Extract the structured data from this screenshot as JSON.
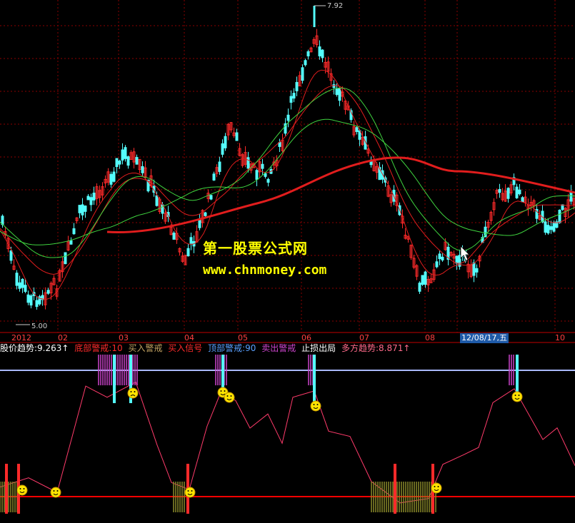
{
  "colors": {
    "background": "#000000",
    "grid": "#8b0000",
    "up_candle": "#ff2a2a",
    "down_candle": "#54fcfc",
    "ma_long": "#e11d1d",
    "ma_mid": "#3fd43f",
    "indicator_line": "#ff3b6b",
    "level_line": "#a9b8ff",
    "base_line": "#ff0000",
    "bottom_warning": "#ff2a2a",
    "buy_warning": "#c0a060",
    "top_warning": "#5aa0ff",
    "sell_warning": "#cc44cc",
    "watermark": "#ffff00"
  },
  "price_panel": {
    "high_label": "7.92",
    "low_label": "5.00",
    "x_axis_labels": [
      "2012",
      "02",
      "03",
      "04",
      "05",
      "06",
      "07",
      "08",
      "10"
    ],
    "cursor_date": "12/08/17,五"
  },
  "watermark": {
    "line1": "第一股票公式网",
    "line2": "www.chnmoney.com"
  },
  "indicator_panel": {
    "legend": [
      {
        "text": "股价趋势:9.263↑",
        "color": "#ffffff"
      },
      {
        "text": "底部警戒:10",
        "color": "#ff2a2a"
      },
      {
        "text": "买入警戒",
        "color": "#c0a060"
      },
      {
        "text": "买入信号",
        "color": "#ff2a2a"
      },
      {
        "text": "顶部警戒:90",
        "color": "#5aa0ff"
      },
      {
        "text": "卖出警戒",
        "color": "#cc44cc"
      },
      {
        "text": "止损出局",
        "color": "#ffffff"
      },
      {
        "text": "多方趋势:8.871↑",
        "color": "#ff6a8a"
      }
    ]
  },
  "chart_data": {
    "type": "line",
    "title": "",
    "series": [],
    "x": [],
    "xlabel": "",
    "ylabel": ""
  }
}
